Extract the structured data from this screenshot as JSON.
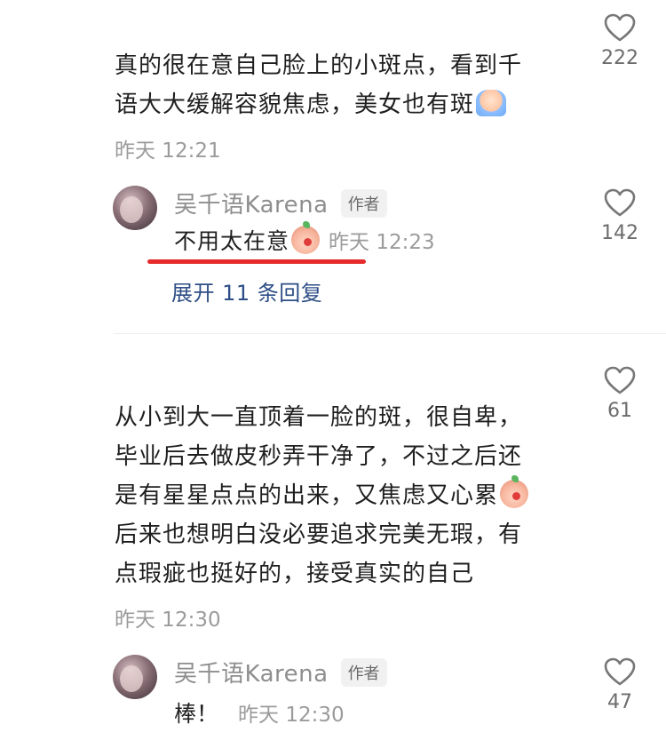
{
  "comments": [
    {
      "text_line1": "真的很在意自己脸上的小斑点，看到千",
      "text_line2": "语大大缓解容貌焦虑，美女也有斑",
      "time": "昨天 12:21",
      "likes": "222",
      "reply": {
        "author": "吴千语Karena",
        "badge": "作者",
        "text": "不用太在意",
        "time": "昨天 12:23",
        "likes": "142",
        "expand": "展开 11 条回复"
      }
    },
    {
      "text_lines": [
        "从小到大一直顶着一脸的斑，很自卑，",
        "毕业后去做皮秒弄干净了，不过之后还",
        "是有星星点点的出来，又焦虑又心累",
        "后来也想明白没必要追求完美无瑕，有",
        "点瑕疵也挺好的，接受真实的自己"
      ],
      "time": "昨天 12:30",
      "likes": "61",
      "reply": {
        "author": "吴千语Karena",
        "badge": "作者",
        "text": "棒！",
        "time": "昨天 12:30",
        "likes": "47"
      }
    }
  ],
  "icons": {
    "like": "heart-outline-icon",
    "reply_emoji": "blushing-face-emoji",
    "crying_emoji": "crying-face-emoji"
  },
  "colors": {
    "annotation_underline": "#e52b2b",
    "expand_link": "#2d4e86",
    "meta_gray": "#9b9b9b"
  }
}
